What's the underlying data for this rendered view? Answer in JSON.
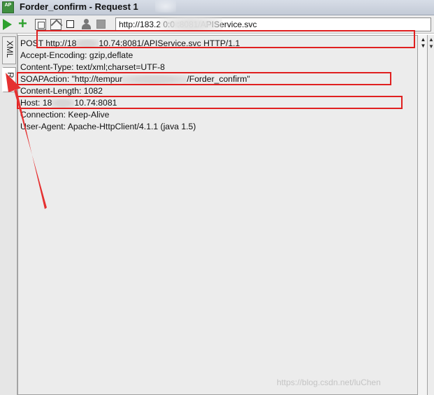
{
  "window": {
    "title": "Forder_confirm - Request 1",
    "icon_label": "AP"
  },
  "toolbar": {
    "url": "http://183.2      0:0      :8081/APIService.svc",
    "icons": [
      "run-icon",
      "add-icon",
      "restore-icon",
      "resize-icon",
      "stop-icon",
      "user-icon",
      "disabled-icon"
    ]
  },
  "tabs": [
    {
      "label": "XML"
    },
    {
      "label": "Raw",
      "selected": true
    }
  ],
  "raw_lines": [
    {
      "before": "POST http://18",
      "after": "10.74:8081/APIService.svc HTTP/1.1"
    },
    {
      "text": "Accept-Encoding: gzip,deflate"
    },
    {
      "text": "Content-Type: text/xml;charset=UTF-8"
    },
    {
      "before": "SOAPAction: \"http://tempur",
      "after": "/Forder_confirm\""
    },
    {
      "text": "Content-Length: 1082"
    },
    {
      "before": "Host: 18",
      "after": "10.74:8081"
    },
    {
      "text": "Connection: Keep-Alive"
    },
    {
      "text": "User-Agent: Apache-HttpClient/4.1.1 (java 1.5)"
    }
  ],
  "annotation": {
    "color": "#e02020"
  },
  "watermark": "https://blog.csdn.net/luChen"
}
